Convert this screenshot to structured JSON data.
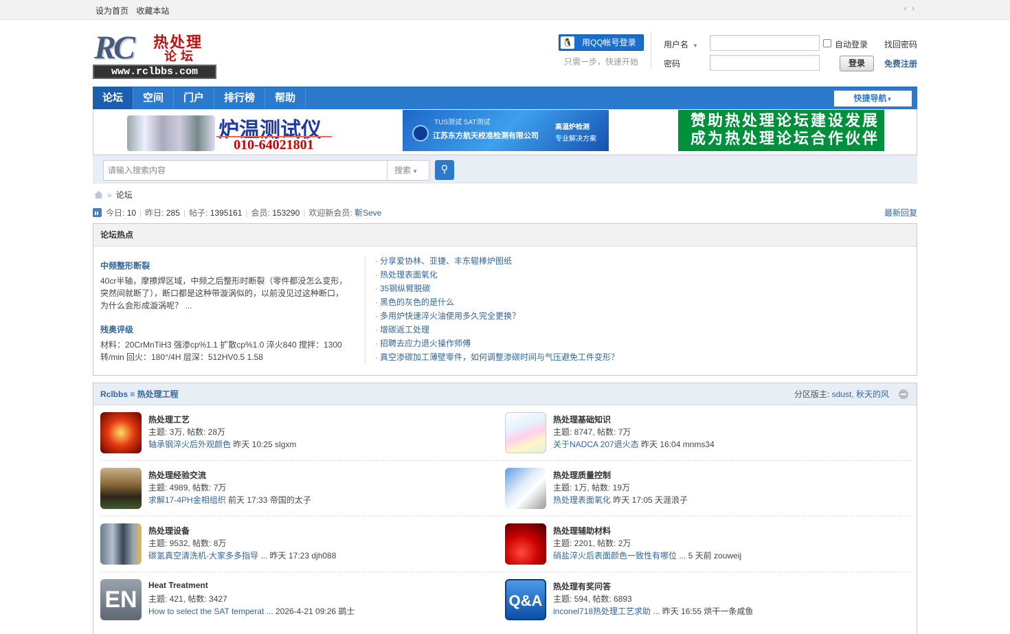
{
  "topbar": {
    "links": [
      "设为首页",
      "收藏本站"
    ],
    "arrows": "‹ ›"
  },
  "logo": {
    "rc": "RC",
    "cn1": "热处理",
    "cn2": "论坛",
    "url": "www.rclbbs.com"
  },
  "login": {
    "qq_label": "用QQ帐号登录",
    "qq_icon": "qq-penguin-icon",
    "qq_hint": "只需一步，快速开始",
    "username_label": "用户名",
    "password_label": "密码",
    "username_value": "",
    "password_value": "",
    "auto_login": "自动登录",
    "login_button": "登录",
    "find_password": "找回密码",
    "register": "免费注册"
  },
  "nav": {
    "items": [
      "论坛",
      "空间",
      "门户",
      "排行榜",
      "帮助"
    ],
    "active": 0,
    "quick": "快捷导航"
  },
  "ads": {
    "ad1": {
      "title": "炉温测试仪",
      "phone": "010-64021801"
    },
    "ad2": {
      "line1": "TUS测试  SAT测试",
      "line2": "江苏东方航天校准检测有限公司",
      "line3": "高温炉检测",
      "line4": "专业解决方案"
    },
    "ad3": {
      "line1": "赞助热处理论坛建设发展",
      "line2": "成为热处理论坛合作伙伴"
    }
  },
  "search": {
    "placeholder": "请输入搜索内容",
    "select": "搜索",
    "button_icon": "search-icon"
  },
  "breadcrumb": {
    "home_icon": "home-icon",
    "current": "论坛"
  },
  "stats": {
    "today_label": "今日:",
    "today": "10",
    "yesterday_label": "昨日:",
    "yesterday": "285",
    "posts_label": "帖子:",
    "posts": "1395161",
    "members_label": "会员:",
    "members": "153290",
    "welcome_label": "欢迎新会员:",
    "newest_member": "靳Seve",
    "latest": "最新回复"
  },
  "hot": {
    "title": "论坛热点",
    "features": [
      {
        "title": "中频整形断裂",
        "desc": "40cr半轴，摩擦焊区域，中频之后整形时断裂（零件都没怎么变形，突然间就断了），断口都是这种带漩涡似的，以前没见过这种断口，为什么会形成漩涡呢？ ..."
      },
      {
        "title": "残奥评级",
        "desc": "材料：20CrMnTiH3 强渗cp%1.1 扩散cp%1.0 淬火840 搅拌：1300转/min 回火：180°/4H 层深：512HV0.5 1.58"
      }
    ],
    "list": [
      "分享爱协林、亚捷、丰东辊棒炉图纸",
      "热处理表面氧化",
      "35钢纵臂脱碳",
      "黑色的灰色的是什么",
      "多用炉快速淬火油使用多久完全更换？",
      "增碳返工处理",
      "招聘去应力退火操作师傅",
      "真空渗碳加工薄壁零件，如何调整渗碳时间与气压避免工件变形？"
    ]
  },
  "section": {
    "title": "Rclbbs ≡ 热处理工程",
    "moderators_label": "分区版主:",
    "moderators": [
      "sdust",
      "秋天的风"
    ],
    "forums": [
      {
        "name": "热处理工艺",
        "counts": "主题: 3万, 帖数: 28万",
        "last_title": "轴承钢淬火后外观颜色",
        "last_meta": " 昨天 10:25 slgxm",
        "icon": "furnace-parts-icon"
      },
      {
        "name": "热处理基础知识",
        "counts": "主题: 8747, 帖数: 7万",
        "last_title": "关于NADCA 207退火态",
        "last_meta": " 昨天 16:04 mnms34",
        "icon": "phase-diagram-icon"
      },
      {
        "name": "热处理经验交流",
        "counts": "主题: 4989, 帖数: 7万",
        "last_title": "求解17-4PH金相组织",
        "last_meta": " 前天 17:33 帝国的太子",
        "icon": "conference-icon"
      },
      {
        "name": "热处理质量控制",
        "counts": "主题: 1万, 帖数: 19万",
        "last_title": "热处理表面氧化",
        "last_meta": " 昨天 17:05 天涯浪子",
        "icon": "microscope-icon"
      },
      {
        "name": "热处理设备",
        "counts": "主题: 9532, 帖数: 8万",
        "last_title": "碳氢真空清洗机-大家多多指导",
        "last_meta": " ... 昨天 17:23 djh088",
        "icon": "equipment-icon"
      },
      {
        "name": "热处理辅助材料",
        "counts": "主题: 2201, 帖数: 2万",
        "last_title": "硝盐淬火后表面颜色一致性有哪位",
        "last_meta": " ... 5 天前 zouweij",
        "icon": "quench-oil-icon"
      },
      {
        "name": "Heat Treatment",
        "counts": "主题: 421, 帖数: 3427",
        "last_title": "How to select the SAT temperat",
        "last_meta": " ... 2026-4-21 09:26 鹚士",
        "icon": "en-icon",
        "icon_text": "EN"
      },
      {
        "name": "热处理有奖问答",
        "counts": "主题: 594, 帖数: 6893",
        "last_title": "inconel718热处理工艺求助",
        "last_meta": " ... 昨天 16:55 烘干一条咸鱼",
        "icon": "qa-icon",
        "icon_text": "Q&A"
      }
    ]
  }
}
